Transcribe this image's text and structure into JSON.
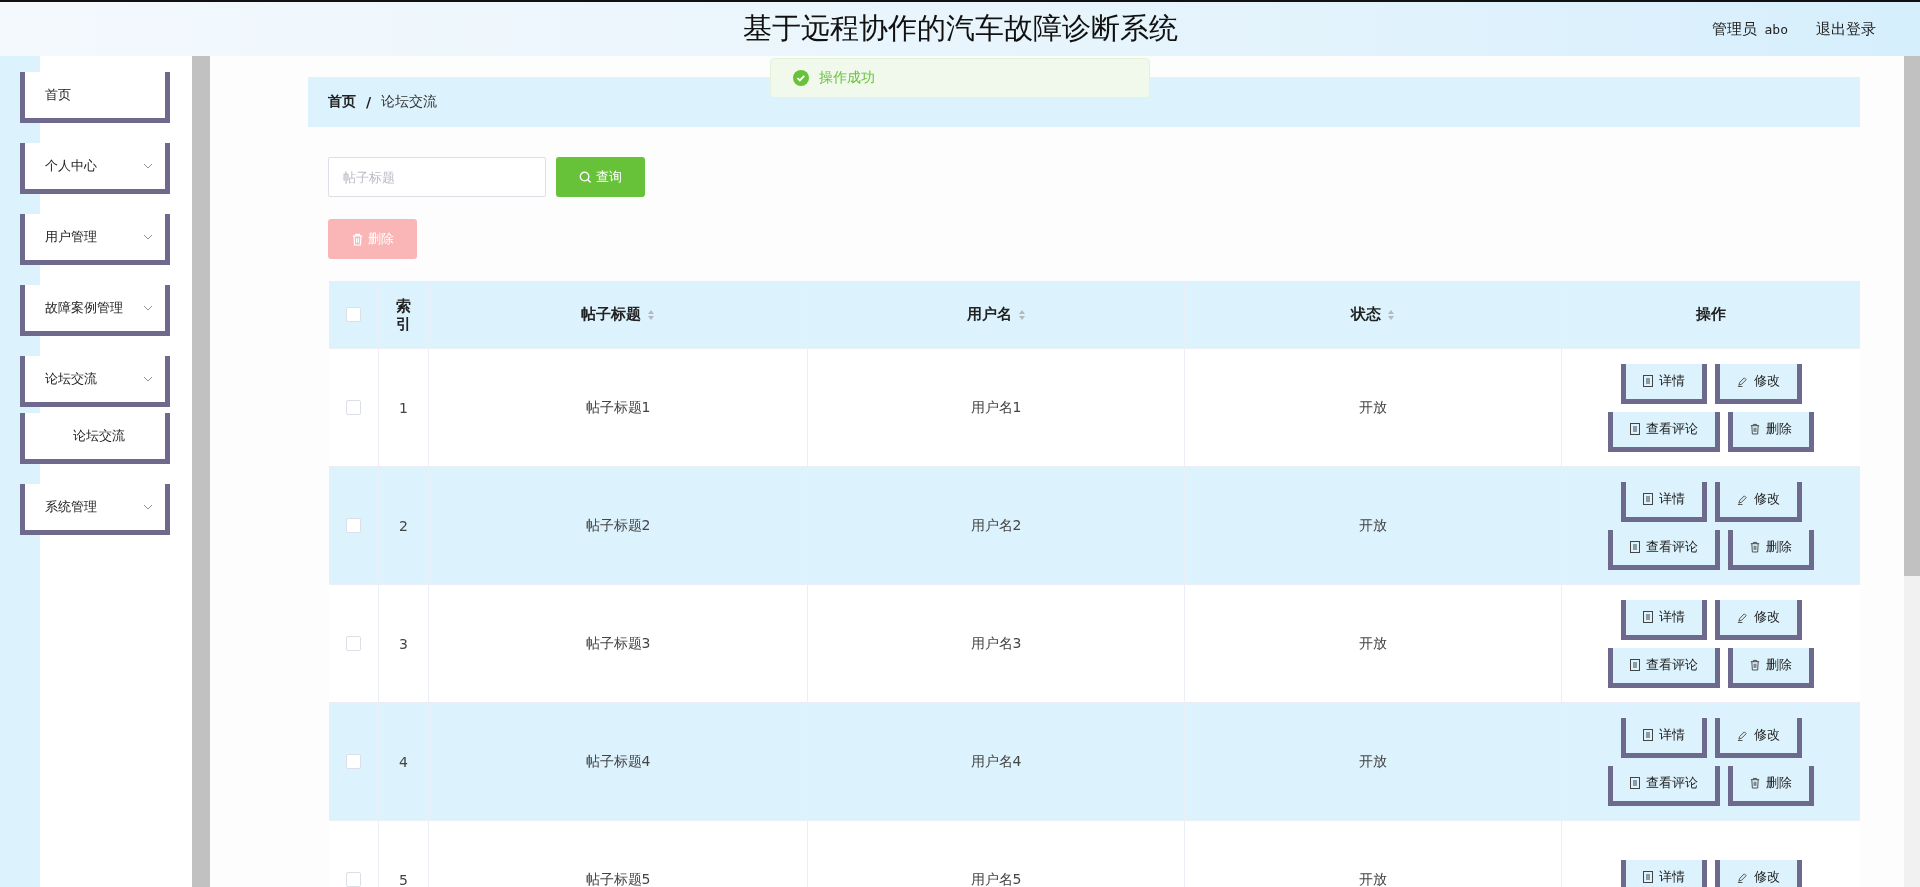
{
  "header": {
    "title": "基于远程协作的汽车故障诊断系统",
    "role": "管理员",
    "username": "abo",
    "logout": "退出登录"
  },
  "toast": {
    "kind": "success",
    "message": "操作成功"
  },
  "sidebar": {
    "items": [
      {
        "label": "首页",
        "kind": "link"
      },
      {
        "label": "个人中心",
        "kind": "submenu"
      },
      {
        "label": "用户管理",
        "kind": "submenu"
      },
      {
        "label": "故障案例管理",
        "kind": "submenu"
      },
      {
        "label": "论坛交流",
        "kind": "submenu",
        "children": [
          {
            "label": "论坛交流"
          }
        ]
      },
      {
        "label": "系统管理",
        "kind": "submenu"
      }
    ]
  },
  "breadcrumb": {
    "separator": "/",
    "items": [
      "首页",
      "论坛交流"
    ]
  },
  "search": {
    "placeholder": "帖子标题",
    "button": "查询"
  },
  "delete_button": {
    "label": "删除",
    "disabled": true
  },
  "table": {
    "header_checked": false,
    "columns": [
      {
        "label": "索引",
        "kind": "plain"
      },
      {
        "label": "帖子标题",
        "kind": "sortable"
      },
      {
        "label": "用户名",
        "kind": "sortable"
      },
      {
        "label": "状态",
        "kind": "sortable"
      },
      {
        "label": "操作",
        "kind": "plain"
      }
    ],
    "rows": [
      {
        "checked": false,
        "index": "1",
        "title": "帖子标题1",
        "user": "用户名1",
        "status": "开放",
        "actions": [
          {
            "kind": "detail",
            "label": "详情"
          },
          {
            "kind": "edit",
            "label": "修改"
          },
          {
            "kind": "comments",
            "label": "查看评论"
          },
          {
            "kind": "delete",
            "label": "删除"
          }
        ]
      },
      {
        "checked": false,
        "index": "2",
        "title": "帖子标题2",
        "user": "用户名2",
        "status": "开放",
        "actions": [
          {
            "kind": "detail",
            "label": "详情"
          },
          {
            "kind": "edit",
            "label": "修改"
          },
          {
            "kind": "comments",
            "label": "查看评论"
          },
          {
            "kind": "delete",
            "label": "删除"
          }
        ]
      },
      {
        "checked": false,
        "index": "3",
        "title": "帖子标题3",
        "user": "用户名3",
        "status": "开放",
        "actions": [
          {
            "kind": "detail",
            "label": "详情"
          },
          {
            "kind": "edit",
            "label": "修改"
          },
          {
            "kind": "comments",
            "label": "查看评论"
          },
          {
            "kind": "delete",
            "label": "删除"
          }
        ]
      },
      {
        "checked": false,
        "index": "4",
        "title": "帖子标题4",
        "user": "用户名4",
        "status": "开放",
        "actions": [
          {
            "kind": "detail",
            "label": "详情"
          },
          {
            "kind": "edit",
            "label": "修改"
          },
          {
            "kind": "comments",
            "label": "查看评论"
          },
          {
            "kind": "delete",
            "label": "删除"
          }
        ]
      },
      {
        "checked": false,
        "index": "5",
        "title": "帖子标题5",
        "user": "用户名5",
        "status": "开放",
        "actions": [
          {
            "kind": "detail",
            "label": "详情"
          },
          {
            "kind": "edit",
            "label": "修改"
          }
        ]
      }
    ]
  }
}
